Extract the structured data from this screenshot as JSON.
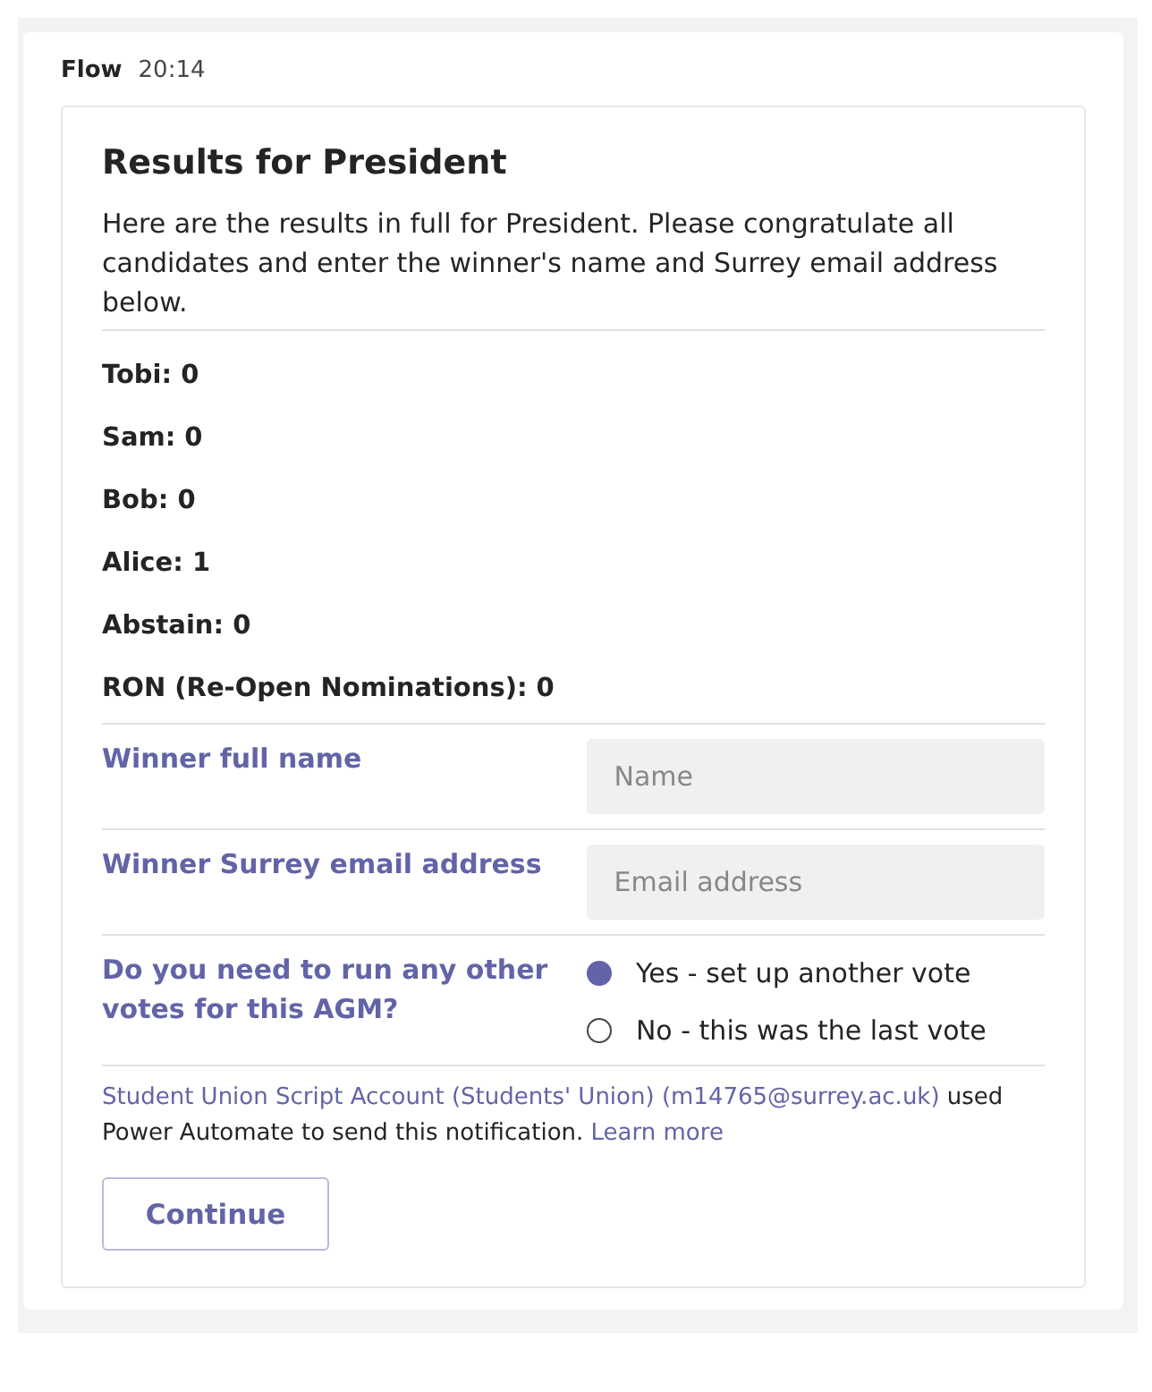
{
  "message": {
    "sender": "Flow",
    "time": "20:14"
  },
  "card": {
    "title": "Results for President",
    "description": "Here are the results in full for President. Please congratulate all candidates and enter the winner's name and Surrey email address below.",
    "results": [
      "Tobi: 0",
      "Sam: 0",
      "Bob: 0",
      "Alice: 1",
      "Abstain: 0",
      "RON (Re-Open Nominations): 0"
    ],
    "fields": [
      {
        "label": "Winner full name",
        "placeholder": "Name"
      },
      {
        "label": "Winner Surrey email address",
        "placeholder": "Email address"
      }
    ],
    "question": {
      "label": "Do you need to run any other votes for this AGM?",
      "options": [
        {
          "label": "Yes - set up another vote",
          "selected": true
        },
        {
          "label": "No - this was the last vote",
          "selected": false
        }
      ]
    },
    "footer": {
      "account_link": "Student Union Script Account (Students' Union) (m14765@surrey.ac.uk)",
      "text": "used Power Automate to send this notification.",
      "learn_more": "Learn more"
    },
    "button": "Continue"
  }
}
